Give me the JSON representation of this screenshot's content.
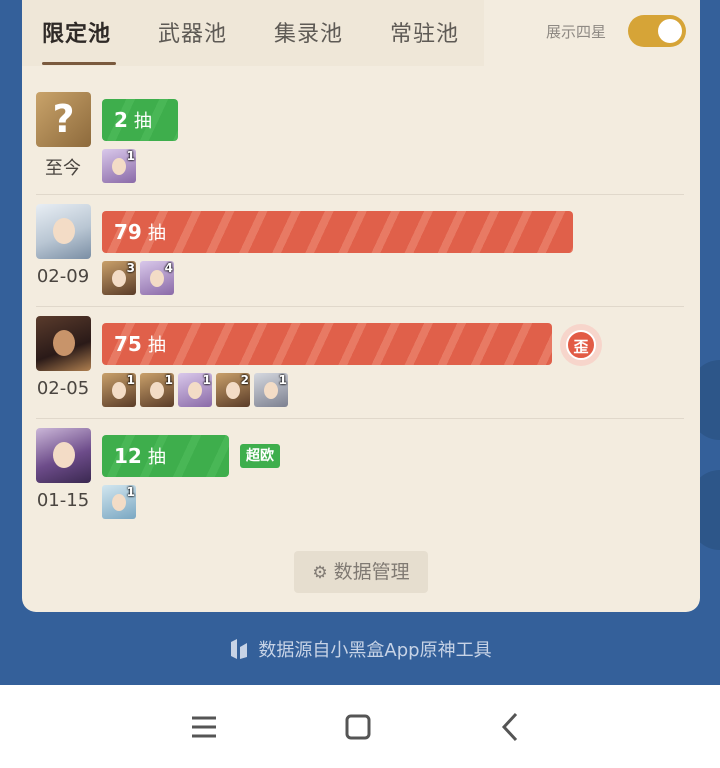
{
  "tabs": [
    {
      "label": "限定池",
      "active": true
    },
    {
      "label": "武器池",
      "active": false
    },
    {
      "label": "集录池",
      "active": false
    },
    {
      "label": "常驻池",
      "active": false
    }
  ],
  "toggle": {
    "label": "展示四星",
    "on": true
  },
  "rows": [
    {
      "date": "至今",
      "avatar": "unknown",
      "avatar_glyph": "?",
      "pulls": "2",
      "unit": "抽",
      "bar_color": "green",
      "tag": "",
      "four_stars": [
        {
          "count": "1",
          "style": "purple"
        }
      ]
    },
    {
      "date": "02-09",
      "avatar": "c1",
      "pulls": "79",
      "unit": "抽",
      "bar_color": "red",
      "tag": "",
      "four_stars": [
        {
          "count": "3",
          "style": "gold"
        },
        {
          "count": "4",
          "style": "purple"
        }
      ]
    },
    {
      "date": "02-05",
      "avatar": "c2",
      "pulls": "75",
      "unit": "抽",
      "bar_color": "red",
      "tag": "歪",
      "four_stars": [
        {
          "count": "1",
          "style": "gold"
        },
        {
          "count": "1",
          "style": "gold"
        },
        {
          "count": "1",
          "style": "purple"
        },
        {
          "count": "2",
          "style": "gold"
        },
        {
          "count": "1",
          "style": "gray"
        }
      ]
    },
    {
      "date": "01-15",
      "avatar": "c3",
      "pulls": "12",
      "unit": "抽",
      "bar_color": "green",
      "tag": "超欧",
      "four_stars": [
        {
          "count": "1",
          "style": "teal"
        }
      ]
    }
  ],
  "data_management": {
    "label": "数据管理",
    "icon": "gear-icon"
  },
  "source_note": "数据源自小黑盒App原神工具",
  "nav": {
    "menu_icon": "menu-icon",
    "home_icon": "home-icon",
    "back_icon": "back-icon"
  },
  "colors": {
    "accent": "#d6a437",
    "bg": "#34609a",
    "card": "#f3ecdf",
    "green": "#3eae4c",
    "red": "#e0604a"
  }
}
